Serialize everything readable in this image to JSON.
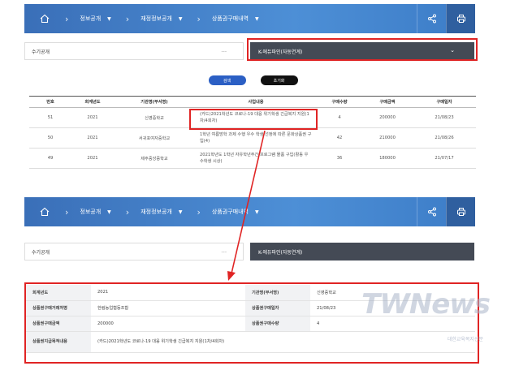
{
  "top": {
    "breadcrumb": [
      "정보공개",
      "재정정보공개",
      "상품권구매내역"
    ],
    "filter_left": "수기공개",
    "filter_dash": "---",
    "filter_right": "K-에듀파인(자동연계)",
    "search_label": "검색",
    "reset_label": "초기화",
    "columns": [
      "번호",
      "회계년도",
      "기관명(부서명)",
      "사업내용",
      "구매수량",
      "구매금액",
      "구매일자"
    ],
    "rows": [
      {
        "no": "51",
        "year": "2021",
        "org": "신영중학교",
        "content": "(카드)2021학년도 코로나-19 대응 위기학생 긴급복지 지원(1차/4회차)",
        "qty": "4",
        "amount": "200000",
        "date": "21/08/23"
      },
      {
        "no": "50",
        "year": "2021",
        "org": "서귀포여자중학교",
        "content": "1학년 여름방학 과제 수행 우수 학생 선정에 따른 문화상품권 구입(4)",
        "qty": "42",
        "amount": "210000",
        "date": "21/08/26"
      },
      {
        "no": "49",
        "year": "2021",
        "org": "제주중앙중학교",
        "content": "2021학년도 1학년 자유학년주간 프로그램 물품 구입(활동 우수학생 시상)",
        "qty": "36",
        "amount": "180000",
        "date": "21/07/17"
      }
    ]
  },
  "bottom": {
    "breadcrumb": [
      "정보공개",
      "재정정보공개",
      "상품권구매내역"
    ],
    "filter_left": "수기공개",
    "filter_dash": "---",
    "filter_right": "K-에듀파인(자동연계)",
    "detail": {
      "year_label": "회계년도",
      "year": "2021",
      "org_label": "기관명(부서명)",
      "org": "신영중학교",
      "seller_label": "상품권구매거래처명",
      "seller": "한림농업협동조합",
      "date_label": "상품권구매일자",
      "date": "21/08/23",
      "amount_label": "상품권구매금액",
      "amount": "200000",
      "qty_label": "상품권구매수량",
      "qty": "4",
      "purpose_label": "상품권지급목적내용",
      "purpose": "(카드)2021학년도 코로나-19 대응 위기학생 긴급복지 지원(1차/4회차)"
    }
  },
  "watermark": "TWNews",
  "watermark_sub": "대한교육복지신문",
  "colors": {
    "nav": "#3a6fb8",
    "highlight": "#e02424",
    "dark_select": "#444a55",
    "search_btn": "#2b5fc4"
  }
}
